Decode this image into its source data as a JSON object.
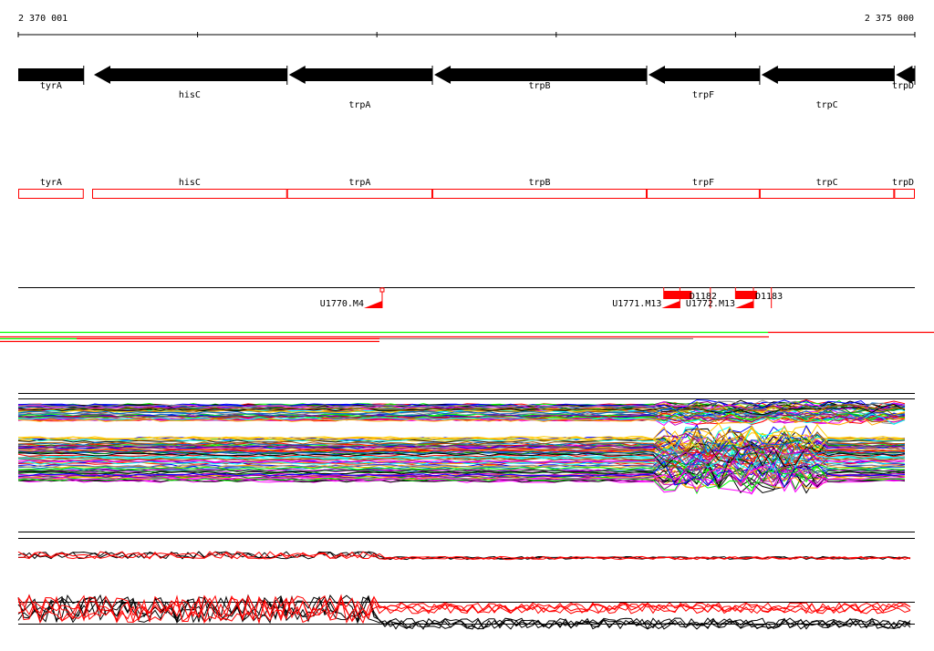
{
  "ruler": {
    "start_label": "2 370 001",
    "end_label": "2 375 000",
    "start": 2370001,
    "end": 2375000
  },
  "genes": [
    {
      "name": "tyrA",
      "start": 2370001,
      "end": 2370366,
      "strand": "+"
    },
    {
      "name": "hisC",
      "start": 2370413,
      "end": 2371500,
      "strand": "-"
    },
    {
      "name": "trpA",
      "start": 2371500,
      "end": 2372310,
      "strand": "-"
    },
    {
      "name": "trpB",
      "start": 2372310,
      "end": 2373505,
      "strand": "-"
    },
    {
      "name": "trpF",
      "start": 2373505,
      "end": 2374135,
      "strand": "-"
    },
    {
      "name": "trpC",
      "start": 2374135,
      "end": 2374885,
      "strand": "-"
    },
    {
      "name": "trpD",
      "start": 2374885,
      "end": 2375000,
      "strand": "-"
    }
  ],
  "features": [
    {
      "label": "U1770.M4",
      "pos": 2372030
    },
    {
      "label": "U1771.M13",
      "pos": 2373690
    },
    {
      "label": "U1772.M13",
      "pos": 2374100
    }
  ],
  "deletions": [
    {
      "label": "D1182",
      "start": 2373600,
      "end": 2373860
    },
    {
      "label": "D1183",
      "start": 2374000,
      "end": 2374200
    }
  ],
  "colors": {
    "accent": "#ff0000",
    "green": "#00ff00",
    "line": "#000000"
  }
}
